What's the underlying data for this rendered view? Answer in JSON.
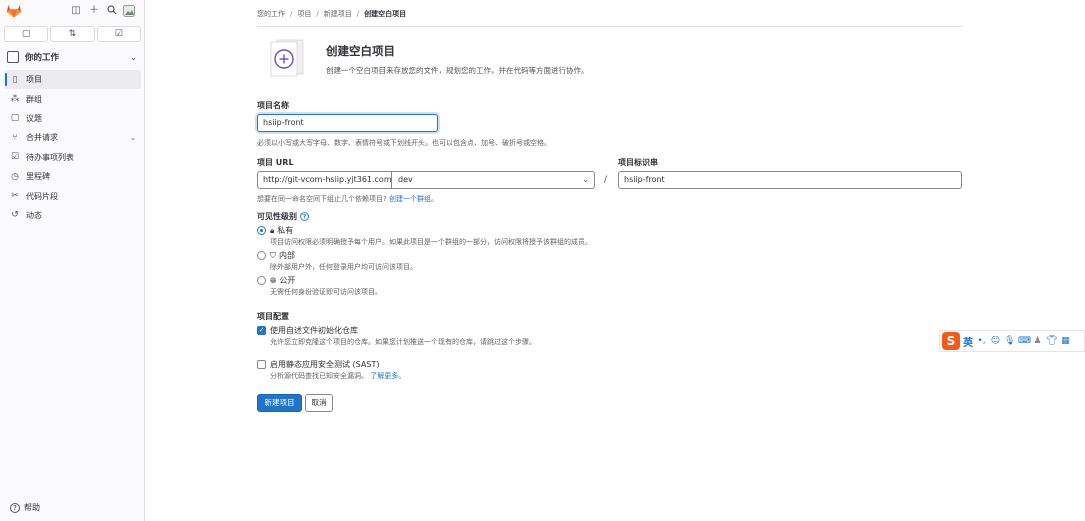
{
  "sidebar": {
    "context_label": "你的工作",
    "items": [
      {
        "label": "项目",
        "icon": "project-icon",
        "active": true
      },
      {
        "label": "群组",
        "icon": "group-icon"
      },
      {
        "label": "议题",
        "icon": "issues-icon"
      },
      {
        "label": "合并请求",
        "icon": "merge-request-icon",
        "has_chevron": true
      },
      {
        "label": "待办事项列表",
        "icon": "todo-icon"
      },
      {
        "label": "里程碑",
        "icon": "milestone-icon"
      },
      {
        "label": "代码片段",
        "icon": "snippet-icon"
      },
      {
        "label": "动态",
        "icon": "activity-icon"
      }
    ],
    "help_label": "帮助"
  },
  "breadcrumbs": {
    "items": [
      "您的工作",
      "项目",
      "新建项目",
      "创建空白项目"
    ]
  },
  "header": {
    "title": "创建空白项目",
    "description": "创建一个空白项目来存放您的文件，规划您的工作，并在代码等方面进行协作。"
  },
  "form": {
    "project_name_label": "项目名称",
    "project_name_value": "hsiip-front",
    "project_name_help": "必须以小写或大写字母、数字、表情符号或下划线开头。也可以包含点、加号、破折号或空格。",
    "project_url_label": "项目 URL",
    "url_prefix": "http://git-vcom-hsiip.yjt361.com/",
    "namespace_value": "dev",
    "slug_label": "项目标识串",
    "slug_value": "hsiip-front",
    "group_hint_prefix": "想要在同一命名空间下组止几个依赖项目?",
    "group_hint_link": "创建一个群组。",
    "visibility_label": "可见性级别",
    "visibility_options": [
      {
        "title": "私有",
        "desc": "项目访问权限必须明确授予每个用户。如果此项目是一个群组的一部分，访问权限将授予该群组的成员。",
        "selected": true,
        "icon": "lock-icon"
      },
      {
        "title": "内部",
        "desc": "除外部用户外，任何登录用户均可访问该项目。",
        "selected": false,
        "icon": "shield-icon"
      },
      {
        "title": "公开",
        "desc": "无需任何身份验证即可访问该项目。",
        "selected": false,
        "icon": "globe-icon"
      }
    ],
    "config_label": "项目配置",
    "config_options": [
      {
        "title": "使用自述文件初始化仓库",
        "desc": "允许您立即克隆这个项目的仓库。如果您计划推送一个现有的仓库，请跳过这个步骤。",
        "checked": true
      },
      {
        "title": "启用静态应用安全测试 (SAST)",
        "desc": "分析源代码查找已知安全漏洞。",
        "link": "了解更多。",
        "checked": false
      }
    ],
    "submit_label": "新建项目",
    "cancel_label": "取消"
  },
  "ime_toolbar": {
    "lang_label": "英"
  }
}
